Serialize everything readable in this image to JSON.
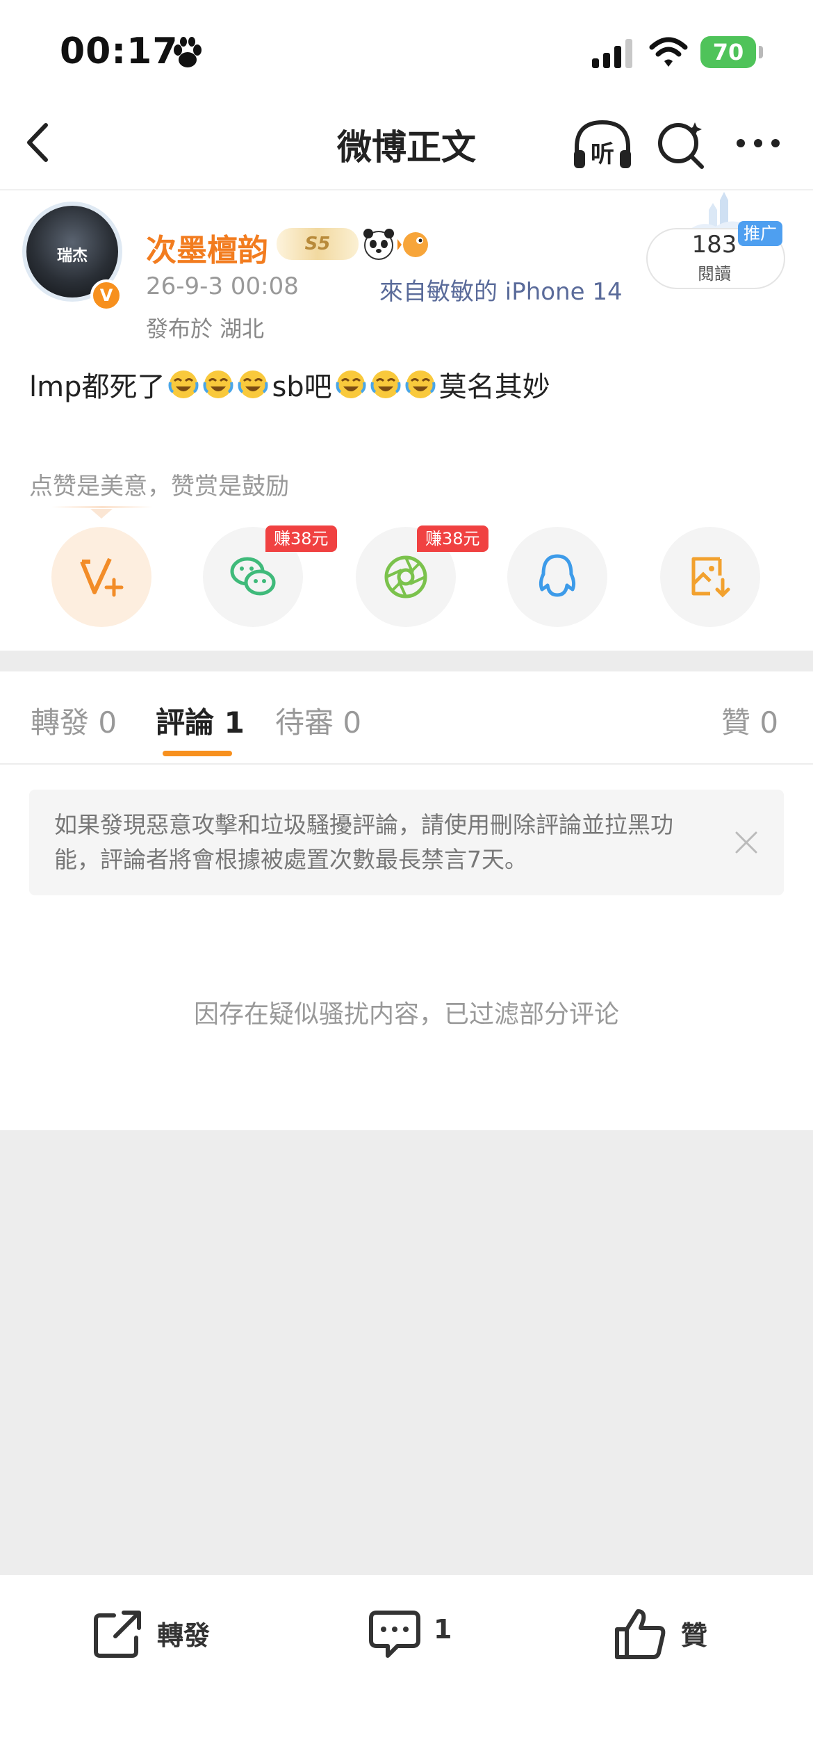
{
  "status_bar": {
    "time": "00:17",
    "battery": "70"
  },
  "nav": {
    "title": "微博正文",
    "listen_label": "听"
  },
  "post": {
    "author": {
      "name": "次墨檀韵",
      "avatar_text": "瑞杰",
      "verified_mark": "V",
      "svip_level": "S5"
    },
    "time": "26-9-3 00:08",
    "source": "來自敏敏的 iPhone 14",
    "location": "發布於 湖北",
    "body_parts": [
      "lmp都死了",
      "sb吧",
      "莫名其妙"
    ],
    "read_count": "183",
    "read_label": "閱讀",
    "promo_tag": "推广"
  },
  "reward": {
    "tip": "点赞是美意，赞赏是鼓励",
    "earn_wechat": "赚38元",
    "earn_moments": "赚38元"
  },
  "tabs": {
    "repost": "轉發 0",
    "comment": "評論 1",
    "pending": "待審 0",
    "like": "贊 0"
  },
  "notice": {
    "text": "如果發現惡意攻擊和垃圾騷擾評論，請使用刪除評論並拉黑功能，評論者將會根據被處置次數最長禁言7天。"
  },
  "filtered_message": "因存在疑似骚扰内容，已过滤部分评论",
  "bottom_bar": {
    "repost": "轉發",
    "comment_count": "1",
    "like": "贊"
  },
  "colors": {
    "accent_orange": "#f7901e",
    "username": "#f27c1f",
    "source_link": "#5a6b9a",
    "earn_red": "#f04141",
    "battery_green": "#4fc35a"
  }
}
